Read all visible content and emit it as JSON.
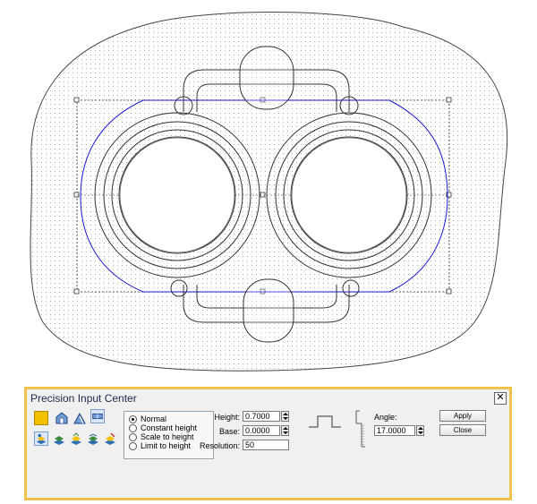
{
  "canvas": {
    "background": "#ffffff",
    "stroke_color": "#333333",
    "selection_color": "#1a1ad0",
    "dot_color": "#9a9a9a"
  },
  "panel": {
    "title": "Precision Input Center",
    "close_label": "✕",
    "border_color": "#f0c24c",
    "color_swatch": "#f2c200",
    "tool_icons_row1": [
      "color-swatch-icon",
      "house-shape-icon",
      "roof-shape-icon",
      "flat-shape-icon"
    ],
    "tool_icons_row2": [
      "layer-tool-icon-1",
      "layer-tool-icon-2",
      "layer-tool-icon-3",
      "layer-tool-icon-4",
      "layer-tool-icon-5"
    ],
    "modes": [
      {
        "label": "Normal",
        "selected": true
      },
      {
        "label": "Constant height",
        "selected": false
      },
      {
        "label": "Scale to height",
        "selected": false
      },
      {
        "label": "Limit to height",
        "selected": false
      }
    ],
    "height_label": "Height:",
    "height_value": "0.7000",
    "base_label": "Base:",
    "base_value": "0.0000",
    "resolution_label": "Resolution:",
    "resolution_value": "50",
    "angle_label": "Angle:",
    "angle_value": "17.0000",
    "apply_label": "Apply",
    "close_button_label": "Close"
  }
}
